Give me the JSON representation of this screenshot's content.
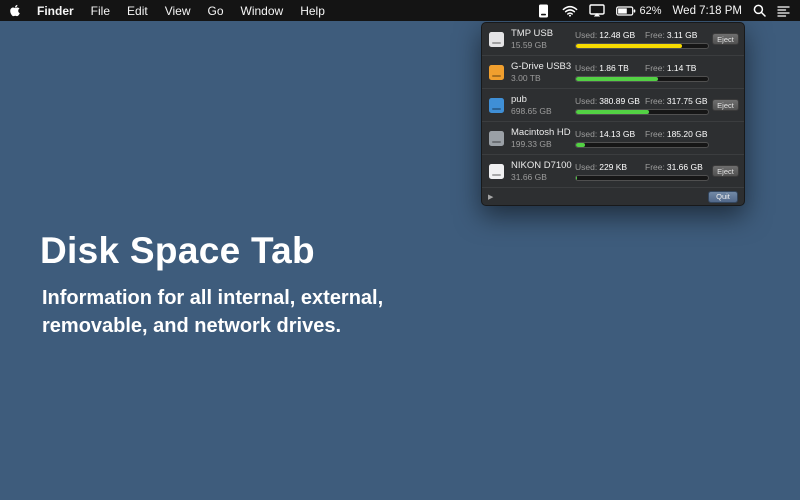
{
  "menu_bar": {
    "app_name": "Finder",
    "menus": [
      "File",
      "Edit",
      "View",
      "Go",
      "Window",
      "Help"
    ],
    "battery_percent": "62%",
    "clock": "Wed 7:18 PM"
  },
  "popover": {
    "used_label": "Used:",
    "free_label": "Free:",
    "eject_label": "Eject",
    "quit_label": "Quit",
    "expand_icon": "▶",
    "drives": [
      {
        "name": "TMP USB",
        "capacity": "15.59 GB",
        "used": "12.48 GB",
        "free": "3.11 GB",
        "percent": 80,
        "bar_color": "#f8dc00",
        "icon_color": "#e4e4e6",
        "eject": true
      },
      {
        "name": "G-Drive USB3",
        "capacity": "3.00 TB",
        "used": "1.86 TB",
        "free": "1.14 TB",
        "percent": 62,
        "bar_color": "#53d144",
        "icon_color": "#f09f2e",
        "eject": false
      },
      {
        "name": "pub",
        "capacity": "698.65 GB",
        "used": "380.89 GB",
        "free": "317.75 GB",
        "percent": 55,
        "bar_color": "#53d144",
        "icon_color": "#3f8fd6",
        "eject": true
      },
      {
        "name": "Macintosh HD",
        "capacity": "199.33 GB",
        "used": "14.13 GB",
        "free": "185.20 GB",
        "percent": 7,
        "bar_color": "#53d144",
        "icon_color": "#9aa0a6",
        "eject": false
      },
      {
        "name": "NIKON D7100",
        "capacity": "31.66 GB",
        "used": "229 KB",
        "free": "31.66 GB",
        "percent": 1,
        "bar_color": "#53d144",
        "icon_color": "#f0f0f2",
        "eject": true
      }
    ]
  },
  "hero": {
    "title": "Disk Space Tab",
    "subtitle_line1": "Information for all internal, external,",
    "subtitle_line2": "removable, and network drives."
  },
  "colors": {
    "desktop": "#3e5c7c",
    "menu_bar": "#141414",
    "popover_bg": "#2d2f31",
    "yellow_bar": "#f8dc00",
    "green_bar": "#53d144"
  }
}
